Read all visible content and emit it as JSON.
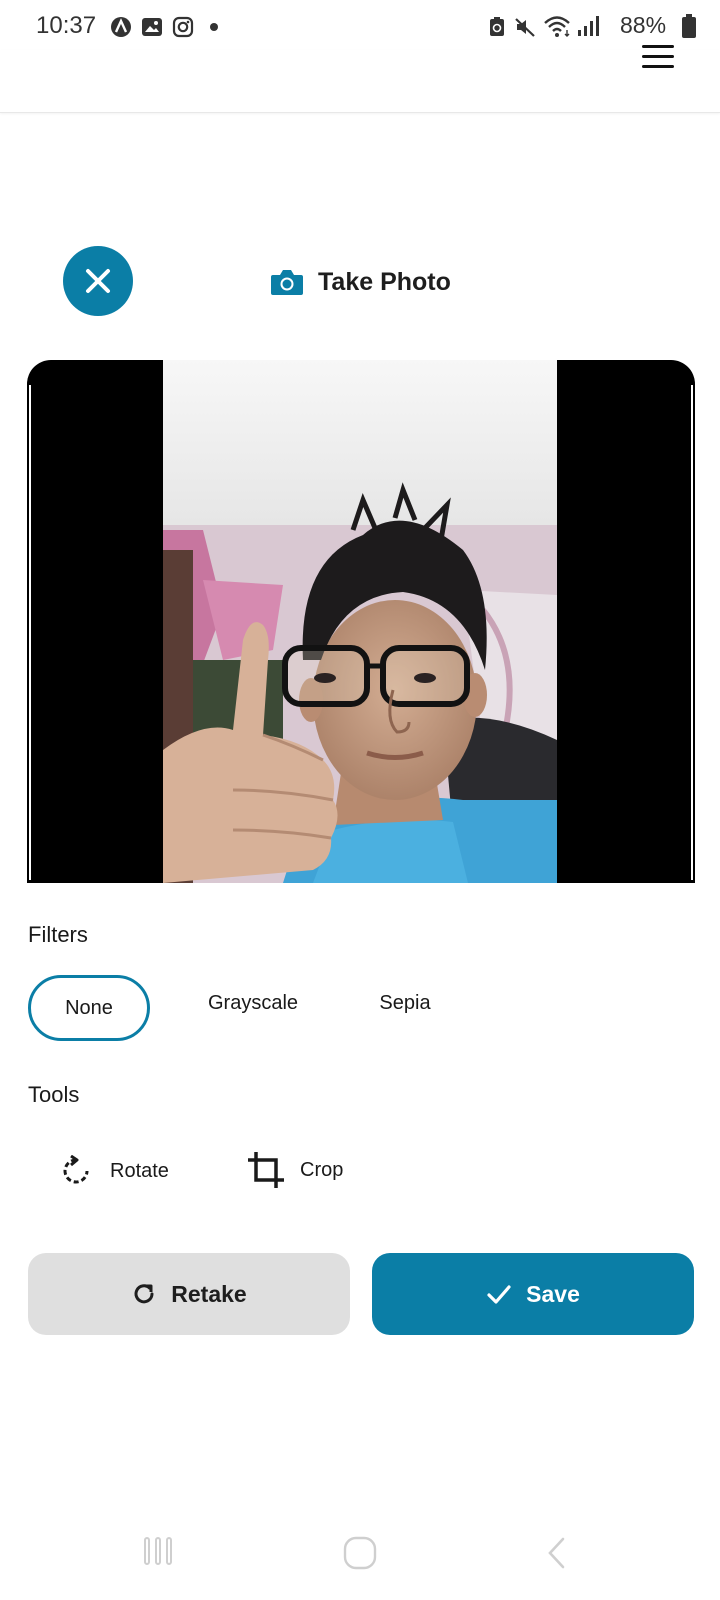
{
  "status_bar": {
    "time": "10:37",
    "battery": "88%",
    "icons": [
      "app-a-icon",
      "gallery-icon",
      "instagram-icon",
      "dot-icon",
      "battery-saver-icon",
      "mute-icon",
      "wifi-icon",
      "signal-icon",
      "battery-icon"
    ]
  },
  "header": {
    "menu_icon": "hamburger-menu-icon"
  },
  "top": {
    "title": "Take Photo",
    "close_icon": "close-icon",
    "camera_icon": "camera-icon"
  },
  "filters": {
    "title": "Filters",
    "options": [
      "None",
      "Grayscale",
      "Sepia"
    ],
    "selected": "None"
  },
  "tools": {
    "title": "Tools",
    "items": [
      {
        "label": "Rotate",
        "icon": "rotate-icon"
      },
      {
        "label": "Crop",
        "icon": "crop-icon"
      }
    ]
  },
  "actions": {
    "retake_label": "Retake",
    "save_label": "Save"
  },
  "colors": {
    "accent": "#0b7ea6",
    "secondary_button": "#dfdfdf"
  }
}
